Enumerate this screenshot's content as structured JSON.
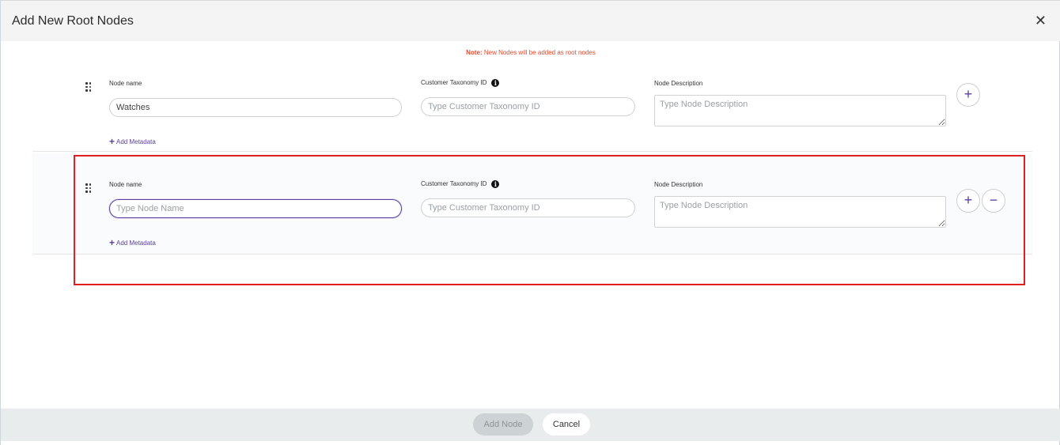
{
  "modal": {
    "title": "Add New Root Nodes",
    "close_icon": "close-icon",
    "close_glyph": "✕"
  },
  "note": {
    "prefix": "Note:",
    "text": " New Nodes will be added as root nodes"
  },
  "rows": [
    {
      "node_name_label": "Node name",
      "node_name_value": "Watches",
      "node_name_placeholder": "Type Node Name",
      "taxonomy_label": "Customer Taxonomy ID",
      "taxonomy_placeholder": "Type Customer Taxonomy ID",
      "description_label": "Node Description",
      "description_placeholder": "Type Node Description",
      "add_metadata": "Add Metadata",
      "add_glyph": "+"
    },
    {
      "node_name_label": "Node name",
      "node_name_value": "",
      "node_name_placeholder": "Type Node Name",
      "taxonomy_label": "Customer Taxonomy ID",
      "taxonomy_placeholder": "Type Customer Taxonomy ID",
      "description_label": "Node Description",
      "description_placeholder": "Type Node Description",
      "add_metadata": "Add Metadata",
      "add_glyph": "+",
      "remove_glyph": "−"
    }
  ],
  "info_glyph": "i",
  "metadata_plus": "+",
  "footer": {
    "add_node_label": "Add Node",
    "cancel_label": "Cancel"
  },
  "colors": {
    "accent": "#5a3e9e",
    "note": "#e8472b",
    "highlight": "#e02020"
  }
}
